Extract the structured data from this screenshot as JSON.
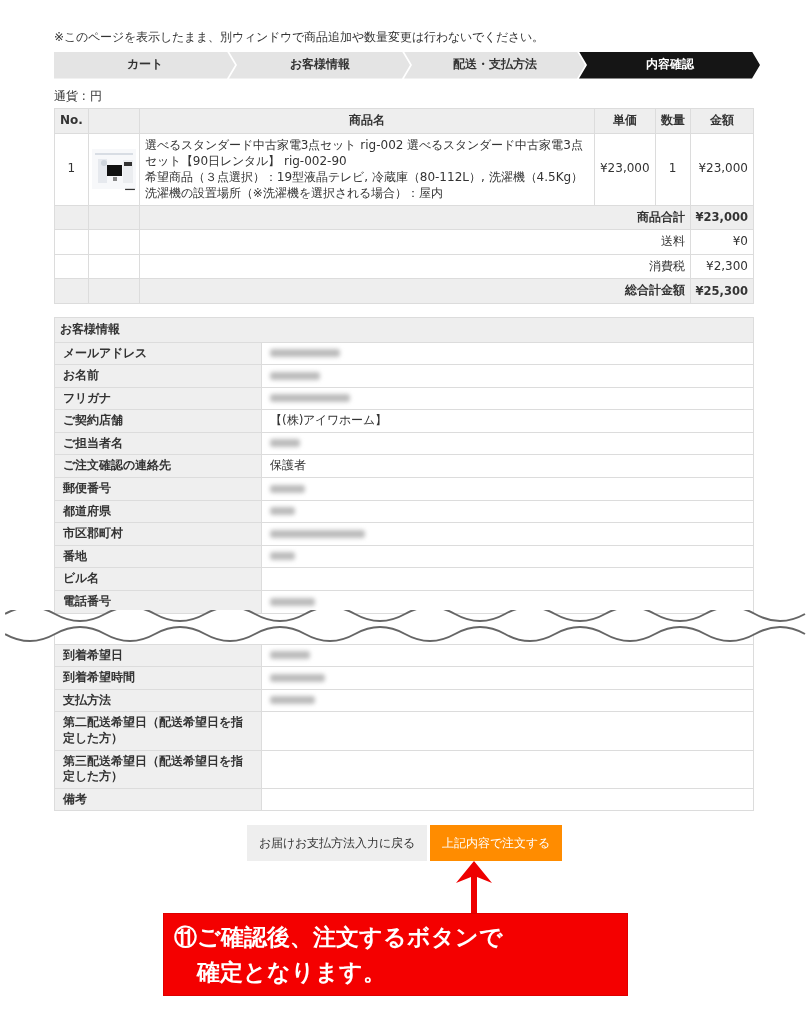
{
  "notice": "※このページを表示したまま、別ウィンドウで商品追加や数量変更は行わないでください。",
  "steps": [
    {
      "label": "カート",
      "selected": false
    },
    {
      "label": "お客様情報",
      "selected": false
    },
    {
      "label": "配送・支払方法",
      "selected": false
    },
    {
      "label": "内容確認",
      "selected": true
    }
  ],
  "currency": "通貨 : 円",
  "cart": {
    "columns": [
      "No.",
      "商品名",
      "単価",
      "数量",
      "金額"
    ],
    "items": [
      {
        "no": "1",
        "thumbnail": {
          "kind": "picture",
          "caption": "ー"
        },
        "lines": [
          "選べるスタンダード中古家電3点セット rig-002 選べるスタンダード中古家電3点セット【90日レンタル】 rig-002-90",
          "希望商品（３点選択）：19型液晶テレビ, 冷蔵庫（80-112L）, 洗濯機（4.5Kg）",
          "洗濯機の設置場所（※洗濯機を選択される場合）：屋内"
        ],
        "price": "¥23,000",
        "qty": "1",
        "amount": "¥23,000"
      }
    ],
    "summary": [
      {
        "kind": "total",
        "label": "商品合計",
        "value": "¥23,000"
      },
      {
        "kind": "plain",
        "label": "送料",
        "value": "¥0"
      },
      {
        "kind": "plain",
        "label": "消費税",
        "value": "¥2,300"
      },
      {
        "kind": "total",
        "label": "総合計金額",
        "value": "¥25,300"
      }
    ]
  },
  "customer": {
    "title": "お客様情報",
    "rows": [
      {
        "kind": "field",
        "label": "メールアドレス",
        "blurred": true
      },
      {
        "kind": "field",
        "label": "お名前",
        "blurred": true
      },
      {
        "kind": "field",
        "label": "フリガナ",
        "blurred": true
      },
      {
        "kind": "field",
        "label": "ご契約店舗",
        "value": "【(株)アイワホーム】"
      },
      {
        "kind": "field",
        "label": "ご担当者名",
        "blurred": true
      },
      {
        "kind": "field",
        "label": "ご注文確認の連絡先",
        "value": "保護者"
      },
      {
        "kind": "field",
        "label": "郵便番号",
        "blurred": true
      },
      {
        "kind": "field",
        "label": "都道府県",
        "blurred": true
      },
      {
        "kind": "field",
        "label": "市区郡町村",
        "blurred": true
      },
      {
        "kind": "field",
        "label": "番地",
        "blurred": true
      },
      {
        "kind": "field",
        "label": "ビル名"
      },
      {
        "kind": "field",
        "label": "電話番号",
        "blurred": true
      },
      {
        "kind": "break"
      },
      {
        "kind": "field",
        "label": "到着希望日",
        "blurred": true
      },
      {
        "kind": "field",
        "label": "到着希望時間",
        "blurred": true
      },
      {
        "kind": "field",
        "label": "支払方法",
        "blurred": true
      },
      {
        "kind": "field",
        "label": "第二配送希望日（配送希望日を指定した方）"
      },
      {
        "kind": "field",
        "label": "第三配送希望日（配送希望日を指定した方）"
      },
      {
        "kind": "field",
        "label": "備考"
      }
    ]
  },
  "buttons": [
    {
      "kind": "secondary",
      "label": "お届けお支払方法入力に戻る"
    },
    {
      "kind": "primary",
      "label": "上記内容で注文する"
    }
  ],
  "callout": {
    "number": "⑪",
    "lines": [
      "ご確認後、注文するボタンで",
      "確定となります。"
    ]
  }
}
